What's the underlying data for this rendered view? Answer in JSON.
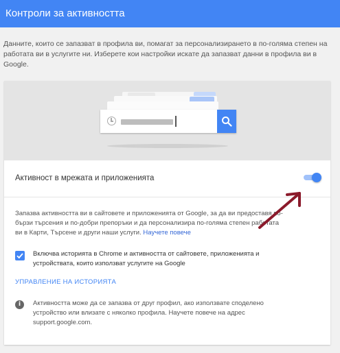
{
  "header": {
    "title": "Контроли за активността"
  },
  "intro": {
    "text": "Данните, които се запазват в профила ви, помагат за персонализирането в по-голяма степен на работата ви в услугите ни. Изберете кои настройки искате да запазват данни в профила ви в Google."
  },
  "setting": {
    "title": "Активност в мрежата и приложенията",
    "enabled": true,
    "description": "Запазва активността ви в сайтовете и приложенията от Google, за да ви предоставя по-бързи търсения и по-добри препоръки и да персонализира по-голяма степен работата ви в Карти, Търсене и други наши услуги.",
    "learn_more": "Научете повече",
    "checkbox_label": "Включва историята в Chrome и активността от сайтовете, приложенията и устройствата, които използват услугите на Google",
    "checkbox_checked": true,
    "manage_link": "УПРАВЛЕНИЕ НА ИСТОРИЯТА",
    "info_text": "Активността може да се запазва от друг профил, ако използвате споделено устройство или влизате с няколко профила. Научете повече на адрес support.google.com."
  },
  "icons": [
    "clock-icon",
    "search-icon",
    "check-icon",
    "info-icon",
    "arrow-annotation"
  ],
  "colors": {
    "accent": "#4285f4",
    "annotation_arrow": "#8b1a2b"
  }
}
